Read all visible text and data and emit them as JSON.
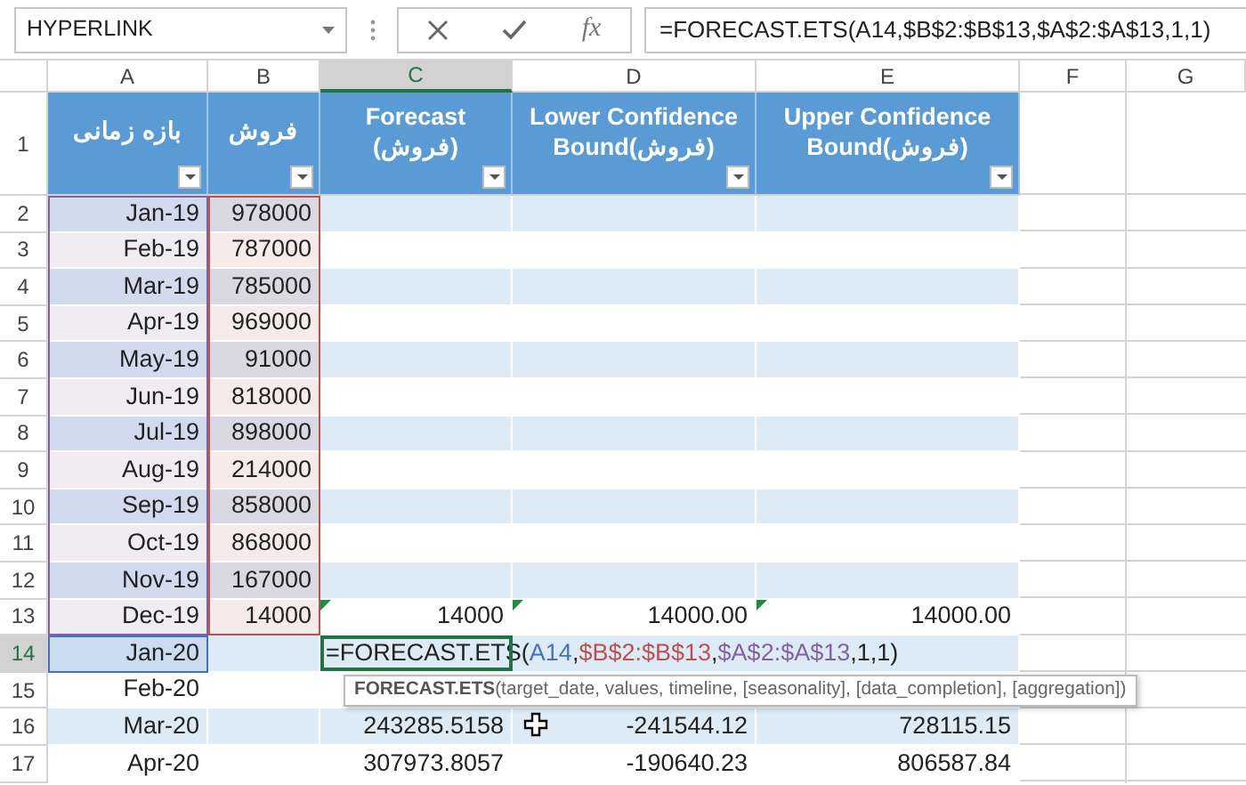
{
  "name_box": {
    "value": "HYPERLINK"
  },
  "formula_bar": {
    "buttons": [
      {
        "kind": "cancel"
      },
      {
        "kind": "enter"
      },
      {
        "kind": "function",
        "label": "fx"
      }
    ],
    "formula": "=FORECAST.ETS(A14,$B$2:$B$13,$A$2:$A$13,1,1)"
  },
  "columns": [
    {
      "label": "A",
      "selected": false
    },
    {
      "label": "B",
      "selected": false
    },
    {
      "label": "C",
      "selected": true
    },
    {
      "label": "D",
      "selected": false
    },
    {
      "label": "E",
      "selected": false
    },
    {
      "label": "F",
      "selected": false
    },
    {
      "label": "G",
      "selected": false
    }
  ],
  "rows": [
    {
      "number": "1",
      "selected": false,
      "kind": "header",
      "cells": {
        "A": {
          "text": "بازه زمانی",
          "filter": true
        },
        "B": {
          "text": "فروش",
          "filter": true
        },
        "C": {
          "text": "Forecast\n(فروش)",
          "filter": true
        },
        "D": {
          "text": "Lower Confidence\nBound(فروش)",
          "filter": true
        },
        "E": {
          "text": "Upper Confidence\nBound(فروش)",
          "filter": true
        }
      }
    },
    {
      "number": "2",
      "selected": false,
      "striped": true,
      "cells": {
        "A": {
          "text": "Jan-19",
          "color": "#8064a2"
        },
        "B": {
          "text": "978000",
          "color": "#c0504d"
        }
      }
    },
    {
      "number": "3",
      "selected": false,
      "striped": false,
      "cells": {
        "A": {
          "text": "Feb-19",
          "color": "#8064a2"
        },
        "B": {
          "text": "787000",
          "color": "#c0504d"
        }
      }
    },
    {
      "number": "4",
      "selected": false,
      "striped": true,
      "cells": {
        "A": {
          "text": "Mar-19",
          "color": "#8064a2"
        },
        "B": {
          "text": "785000",
          "color": "#c0504d"
        }
      }
    },
    {
      "number": "5",
      "selected": false,
      "striped": false,
      "cells": {
        "A": {
          "text": "Apr-19",
          "color": "#8064a2"
        },
        "B": {
          "text": "969000",
          "color": "#c0504d"
        }
      }
    },
    {
      "number": "6",
      "selected": false,
      "striped": true,
      "cells": {
        "A": {
          "text": "May-19",
          "color": "#8064a2"
        },
        "B": {
          "text": "91000",
          "color": "#c0504d"
        }
      }
    },
    {
      "number": "7",
      "selected": false,
      "striped": false,
      "cells": {
        "A": {
          "text": "Jun-19",
          "color": "#8064a2"
        },
        "B": {
          "text": "818000",
          "color": "#c0504d"
        }
      }
    },
    {
      "number": "8",
      "selected": false,
      "striped": true,
      "cells": {
        "A": {
          "text": "Jul-19",
          "color": "#8064a2"
        },
        "B": {
          "text": "898000",
          "color": "#c0504d"
        }
      }
    },
    {
      "number": "9",
      "selected": false,
      "striped": false,
      "cells": {
        "A": {
          "text": "Aug-19",
          "color": "#8064a2"
        },
        "B": {
          "text": "214000",
          "color": "#c0504d"
        }
      }
    },
    {
      "number": "10",
      "selected": false,
      "striped": true,
      "cells": {
        "A": {
          "text": "Sep-19",
          "color": "#8064a2"
        },
        "B": {
          "text": "858000",
          "color": "#c0504d"
        }
      }
    },
    {
      "number": "11",
      "selected": false,
      "striped": false,
      "cells": {
        "A": {
          "text": "Oct-19",
          "color": "#8064a2"
        },
        "B": {
          "text": "868000",
          "color": "#c0504d"
        }
      }
    },
    {
      "number": "12",
      "selected": false,
      "striped": true,
      "cells": {
        "A": {
          "text": "Nov-19",
          "color": "#8064a2"
        },
        "B": {
          "text": "167000",
          "color": "#c0504d"
        }
      }
    },
    {
      "number": "13",
      "selected": false,
      "striped": false,
      "cells": {
        "A": {
          "text": "Dec-19",
          "color": "#8064a2"
        },
        "B": {
          "text": "14000",
          "color": "#c0504d"
        },
        "C": {
          "text": "14000",
          "flag": true
        },
        "D": {
          "text": "14000.00",
          "flag": true
        },
        "E": {
          "text": "14000.00",
          "flag": true
        }
      }
    },
    {
      "number": "14",
      "selected": true,
      "striped": true,
      "cells": {
        "A": {
          "text": "Jan-20",
          "color": "#4472c4"
        },
        "C": {
          "kind": "editing",
          "parts": [
            {
              "text": "=FORECAST.ETS("
            },
            {
              "text": "A14",
              "color": "#4472c4"
            },
            {
              "text": ","
            },
            {
              "text": "$B$2:$B$13",
              "color": "#c0504d"
            },
            {
              "text": ","
            },
            {
              "text": "$A$2:$A$13",
              "color": "#8064a2"
            },
            {
              "text": ",1,1)"
            }
          ]
        }
      }
    },
    {
      "number": "15",
      "selected": false,
      "striped": false,
      "cells": {
        "A": {
          "text": "Feb-20"
        }
      }
    },
    {
      "number": "16",
      "selected": false,
      "striped": true,
      "cells": {
        "A": {
          "text": "Mar-20"
        },
        "C": {
          "text": "243285.5158"
        },
        "D": {
          "text": "-241544.12",
          "cursor": true
        },
        "E": {
          "text": "728115.15"
        }
      }
    },
    {
      "number": "17",
      "selected": false,
      "striped": false,
      "cells": {
        "A": {
          "text": "Apr-20"
        },
        "C": {
          "text": "307973.8057"
        },
        "D": {
          "text": "-190640.23"
        },
        "E": {
          "text": "806587.84"
        }
      }
    }
  ],
  "tooltip": {
    "text": "**FORECAST.ETS**(target_date, values, timeline, [seasonality], [data_completion], [aggregation])"
  }
}
